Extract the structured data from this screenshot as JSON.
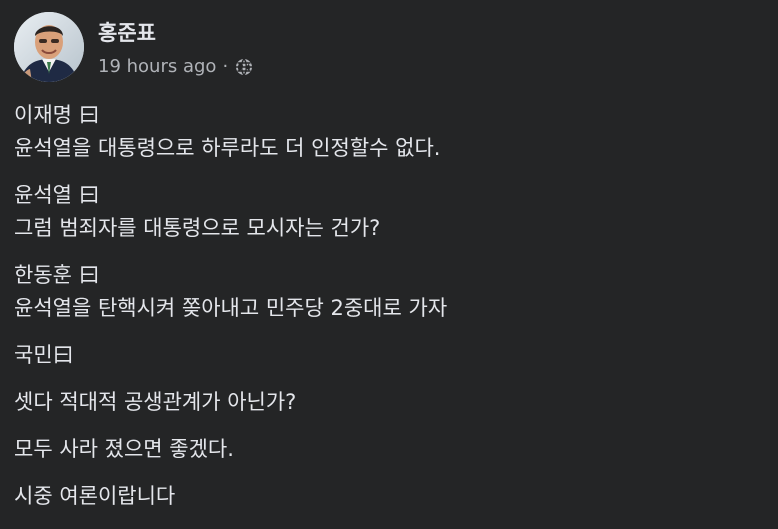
{
  "post": {
    "author": "홍준표",
    "timestamp": "19 hours ago",
    "separator": "·",
    "privacy_icon": "globe-icon",
    "paragraphs": [
      [
        "이재명 曰",
        "윤석열을 대통령으로 하루라도 더 인정할수 없다."
      ],
      [
        "윤석열 曰",
        "그럼 범죄자를 대통령으로 모시자는 건가?"
      ],
      [
        "한동훈 曰",
        "윤석열을 탄핵시켜 쫒아내고 민주당 2중대로 가자"
      ],
      [
        "국민曰"
      ],
      [
        "셋다 적대적 공생관계가 아닌가?"
      ],
      [
        "모두 사라 졌으면 좋겠다."
      ],
      [
        "시중 여론이랍니다"
      ]
    ]
  },
  "colors": {
    "background": "#242526",
    "primary_text": "#e4e6eb",
    "secondary_text": "#b0b3b8"
  }
}
